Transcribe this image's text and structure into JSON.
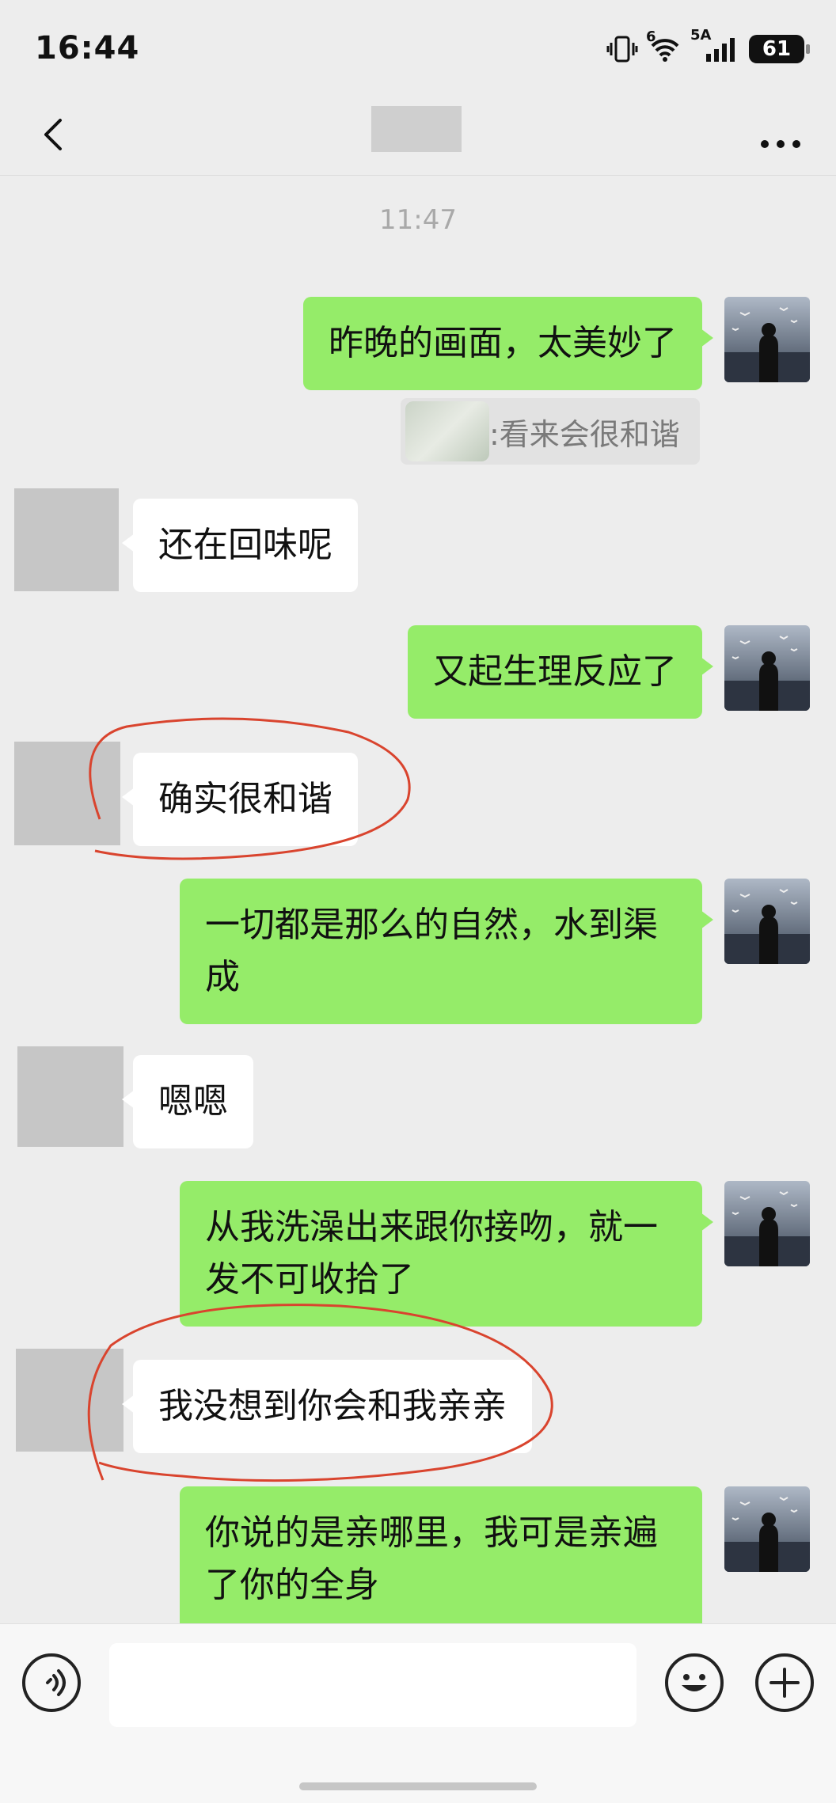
{
  "status_bar": {
    "time": "16:44",
    "signal_labels": [
      "6",
      "5A"
    ],
    "battery": "61"
  },
  "nav": {
    "back_icon": "chevron-left-icon",
    "more_icon": "ellipsis-icon"
  },
  "chat": {
    "timestamp": "11:47",
    "quote_text": ":看来会很和谐",
    "messages": [
      {
        "from": "me",
        "text": "昨晚的画面，太美妙了"
      },
      {
        "from": "other",
        "text": "还在回味呢"
      },
      {
        "from": "me",
        "text": "又起生理反应了"
      },
      {
        "from": "other",
        "text": "确实很和谐"
      },
      {
        "from": "me",
        "text": "一切都是那么的自然，水到渠\n成"
      },
      {
        "from": "other",
        "text": "嗯嗯"
      },
      {
        "from": "me",
        "text": "从我洗澡出来跟你接吻，就一\n发不可收拾了"
      },
      {
        "from": "other",
        "text": "我没想到你会和我亲亲"
      },
      {
        "from": "me",
        "text": "你说的是亲哪里，我可是亲遍\n了你的全身"
      }
    ]
  },
  "colors": {
    "my_bubble": "#95ec69",
    "other_bubble": "#ffffff",
    "annotation": "#d9442e"
  }
}
